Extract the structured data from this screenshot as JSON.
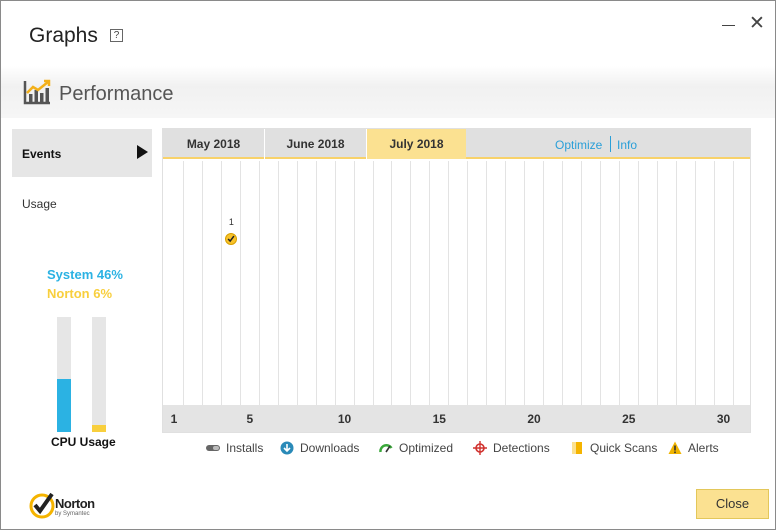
{
  "window": {
    "title": "Graphs",
    "help_label": "?",
    "close_glyph": "✕"
  },
  "section": {
    "title": "Performance",
    "icon": "performance-chart-icon"
  },
  "sidebar": {
    "events_label": "Events",
    "usage_label": "Usage",
    "system_label": "System 46%",
    "norton_label": "Norton 6%",
    "system_percent": 46,
    "norton_percent": 6,
    "cpu_label": "CPU Usage"
  },
  "chart": {
    "tabs": [
      {
        "label": "May 2018",
        "selected": false
      },
      {
        "label": "June 2018",
        "selected": false
      },
      {
        "label": "July 2018",
        "selected": true
      }
    ],
    "links": {
      "optimize": "Optimize",
      "info": "Info"
    },
    "x_ticks": [
      "1",
      "5",
      "10",
      "15",
      "20",
      "25",
      "30"
    ],
    "events": [
      {
        "day": 4,
        "type": "Installs",
        "count": "1"
      }
    ]
  },
  "legend": [
    {
      "label": "Installs",
      "icon": "installs-icon",
      "color": "#666666"
    },
    {
      "label": "Downloads",
      "icon": "downloads-icon",
      "color": "#2a8ab8"
    },
    {
      "label": "Optimized",
      "icon": "optimized-icon",
      "color": "#3aa83a"
    },
    {
      "label": "Detections",
      "icon": "detections-icon",
      "color": "#d0312d"
    },
    {
      "label": "Quick Scans",
      "icon": "quick-scans-icon",
      "color": "#f5b400"
    },
    {
      "label": "Alerts",
      "icon": "alerts-icon",
      "color": "#f0b400"
    }
  ],
  "footer": {
    "logo_text": "Norton",
    "logo_subtext": "by Symantec",
    "close_label": "Close"
  },
  "colors": {
    "accent_yellow": "#fbe191",
    "system_blue": "#2bb2e3",
    "norton_yellow": "#f8cf3d",
    "link_blue": "#2a9fd8"
  }
}
